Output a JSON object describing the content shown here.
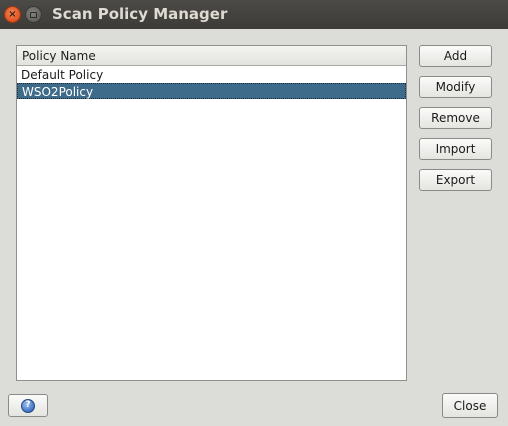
{
  "window": {
    "title": "Scan Policy Manager",
    "close_glyph": "×",
    "minimize_icon": "window-minimize-icon"
  },
  "table": {
    "header": "Policy Name",
    "rows": [
      "Default Policy",
      "WSO2Policy"
    ],
    "selected_index": 1
  },
  "actions": {
    "add": "Add",
    "modify": "Modify",
    "remove": "Remove",
    "import": "Import",
    "export": "Export"
  },
  "footer": {
    "help_icon": "help-icon",
    "help_glyph": "?",
    "close": "Close"
  },
  "colors": {
    "selection": "#3e6b8a",
    "titlebar": "#3c3b37",
    "close_button": "#e0531d",
    "background": "#dcdcd8"
  }
}
